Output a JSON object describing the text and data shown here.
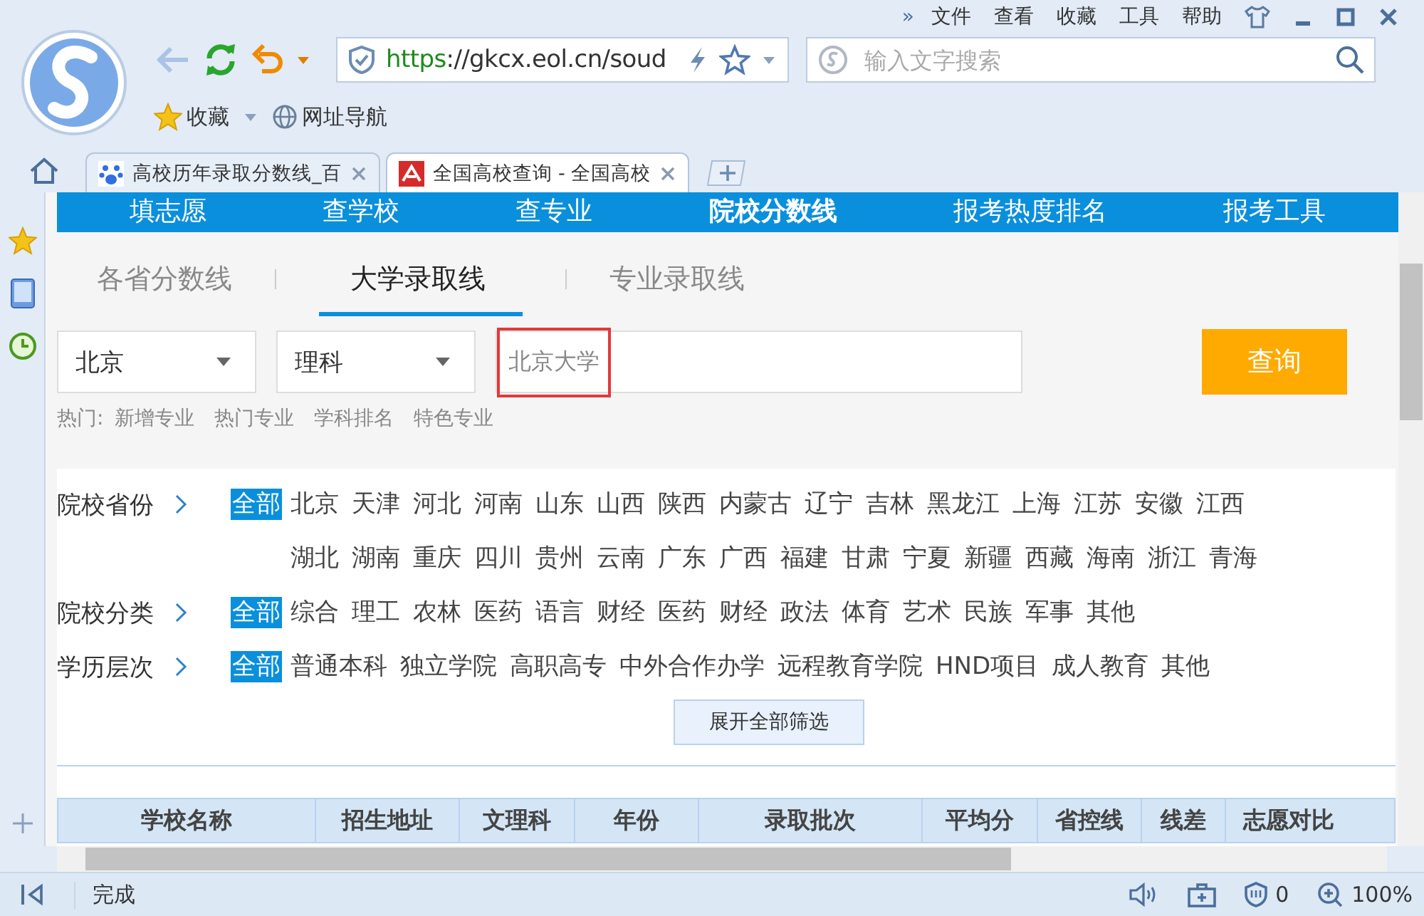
{
  "menu": [
    "»",
    "文件",
    "查看",
    "收藏",
    "工具",
    "帮助"
  ],
  "address": {
    "scheme": "https",
    "url": "://gkcx.eol.cn/soud"
  },
  "search": {
    "placeholder": "输入文字搜索"
  },
  "bookmarks": [
    "收藏",
    "网址导航"
  ],
  "tabs": [
    {
      "title": "高校历年录取分数线_百",
      "selected": false
    },
    {
      "title": "全国高校查询 - 全国高校",
      "selected": true
    }
  ],
  "site_nav": [
    {
      "label": "填志愿",
      "selected": false
    },
    {
      "label": "查学校",
      "selected": false
    },
    {
      "label": "查专业",
      "selected": false
    },
    {
      "label": "院校分数线",
      "selected": true
    },
    {
      "label": "报考热度排名",
      "selected": false
    },
    {
      "label": "报考工具",
      "selected": false
    }
  ],
  "sub_tabs": [
    {
      "label": "各省分数线",
      "selected": false
    },
    {
      "label": "大学录取线",
      "selected": true
    },
    {
      "label": "专业录取线",
      "selected": false
    }
  ],
  "form": {
    "province": "北京",
    "subject": "理科",
    "query": "北京大学",
    "query_highlighted": true,
    "button": "查询"
  },
  "hot": {
    "label": "热门:",
    "links": [
      "新增专业",
      "热门专业",
      "学科排名",
      "特色专业"
    ]
  },
  "filters": [
    {
      "label": "院校省份",
      "options": [
        {
          "text": "全部",
          "selected": true
        },
        {
          "text": "北京",
          "selected": false
        },
        {
          "text": "天津",
          "selected": false
        },
        {
          "text": "河北",
          "selected": false
        },
        {
          "text": "河南",
          "selected": false
        },
        {
          "text": "山东",
          "selected": false
        },
        {
          "text": "山西",
          "selected": false
        },
        {
          "text": "陕西",
          "selected": false
        },
        {
          "text": "内蒙古",
          "selected": false
        },
        {
          "text": "辽宁",
          "selected": false
        },
        {
          "text": "吉林",
          "selected": false
        },
        {
          "text": "黑龙江",
          "selected": false
        },
        {
          "text": "上海",
          "selected": false
        },
        {
          "text": "江苏",
          "selected": false
        },
        {
          "text": "安徽",
          "selected": false
        },
        {
          "text": "江西",
          "selected": false
        },
        {
          "text": "湖北",
          "selected": false
        },
        {
          "text": "湖南",
          "selected": false
        },
        {
          "text": "重庆",
          "selected": false
        },
        {
          "text": "四川",
          "selected": false
        },
        {
          "text": "贵州",
          "selected": false
        },
        {
          "text": "云南",
          "selected": false
        },
        {
          "text": "广东",
          "selected": false
        },
        {
          "text": "广西",
          "selected": false
        },
        {
          "text": "福建",
          "selected": false
        },
        {
          "text": "甘肃",
          "selected": false
        },
        {
          "text": "宁夏",
          "selected": false
        },
        {
          "text": "新疆",
          "selected": false
        },
        {
          "text": "西藏",
          "selected": false
        },
        {
          "text": "海南",
          "selected": false
        },
        {
          "text": "浙江",
          "selected": false
        },
        {
          "text": "青海",
          "selected": false
        }
      ]
    },
    {
      "label": "院校分类",
      "options": [
        {
          "text": "全部",
          "selected": true
        },
        {
          "text": "综合",
          "selected": false
        },
        {
          "text": "理工",
          "selected": false
        },
        {
          "text": "农林",
          "selected": false
        },
        {
          "text": "医药",
          "selected": false
        },
        {
          "text": "语言",
          "selected": false
        },
        {
          "text": "财经",
          "selected": false
        },
        {
          "text": "医药",
          "selected": false
        },
        {
          "text": "财经",
          "selected": false
        },
        {
          "text": "政法",
          "selected": false
        },
        {
          "text": "体育",
          "selected": false
        },
        {
          "text": "艺术",
          "selected": false
        },
        {
          "text": "民族",
          "selected": false
        },
        {
          "text": "军事",
          "selected": false
        },
        {
          "text": "其他",
          "selected": false
        }
      ]
    },
    {
      "label": "学历层次",
      "options": [
        {
          "text": "全部",
          "selected": true
        },
        {
          "text": "普通本科",
          "selected": false
        },
        {
          "text": "独立学院",
          "selected": false
        },
        {
          "text": "高职高专",
          "selected": false
        },
        {
          "text": "中外合作办学",
          "selected": false
        },
        {
          "text": "远程教育学院",
          "selected": false
        },
        {
          "text": "HND项目",
          "selected": false
        },
        {
          "text": "成人教育",
          "selected": false
        },
        {
          "text": "其他",
          "selected": false
        }
      ]
    }
  ],
  "expand_button": "展开全部筛选",
  "table": {
    "columns": [
      "学校名称",
      "招生地址",
      "文理科",
      "年份",
      "录取批次",
      "平均分",
      "省控线",
      "线差",
      "志愿对比"
    ]
  },
  "status_bar": {
    "text": "完成",
    "count": "0",
    "zoom": "100%"
  }
}
